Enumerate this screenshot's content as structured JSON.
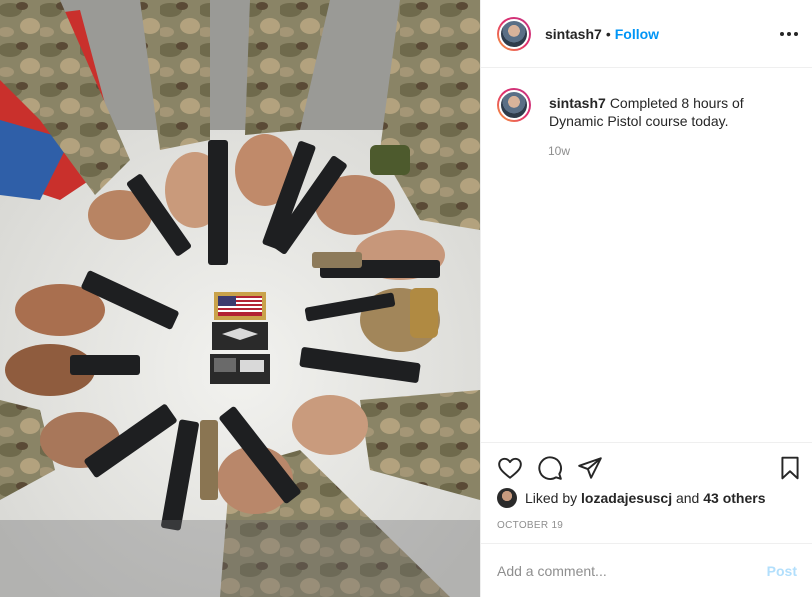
{
  "post": {
    "photo_label": "Group of hands holding pistols in a circle around patches",
    "author": "sintash7",
    "separator": "•",
    "follow_label": "Follow",
    "more_label": "•••",
    "caption_text": "Completed 8 hours of Dynamic Pistol course today.",
    "caption_time": "10w",
    "liked_by_prefix": "Liked by",
    "liked_by_user": "lozadajesuscj",
    "liked_by_and": "and",
    "liked_by_others": "43 others",
    "date": "OCTOBER 19",
    "comment_placeholder": "Add a comment...",
    "post_label": "Post"
  },
  "icons": {
    "like": "heart-icon",
    "comment": "comment-icon",
    "share": "share-icon",
    "save": "bookmark-icon",
    "more": "more-icon"
  },
  "colors": {
    "link_blue": "#0095f6",
    "post_disabled": "#b2dffc",
    "muted": "#8e8e8e"
  }
}
